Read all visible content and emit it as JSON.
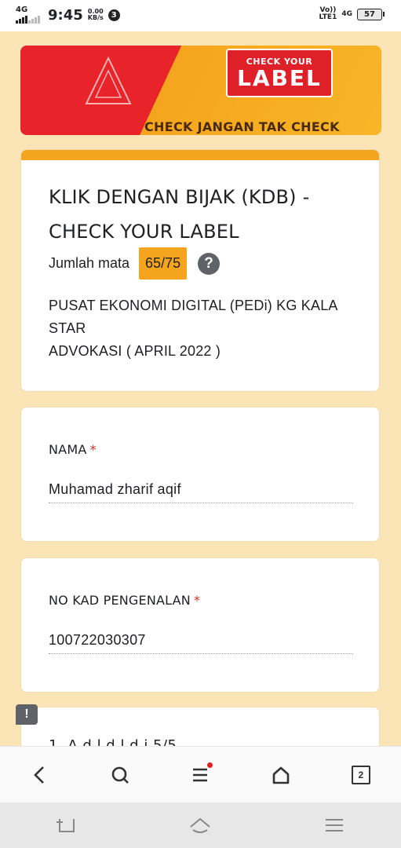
{
  "status_bar": {
    "signal_label": "4G",
    "time": "9:45",
    "speed_value": "0.00",
    "speed_unit": "KB/s",
    "notification_count": "3",
    "volte_top": "Vo))",
    "volte_bottom": "LTE1",
    "network_right": "4G",
    "battery": "57"
  },
  "banner": {
    "sign_top": "CHECK YOUR",
    "sign_main": "LABEL",
    "tagline": "CHECK JANGAN TAK CHECK",
    "accent_red": "#e8232a",
    "accent_orange": "#f5a51d"
  },
  "form": {
    "title": "KLIK DENGAN BIJAK (KDB) - CHECK YOUR LABEL",
    "score_label": "Jumlah mata",
    "score_value": "65/75",
    "description_line1": "PUSAT EKONOMI DIGITAL (PEDi) KG KALA STAR",
    "description_line2": "ADVOKASI ( APRIL 2022 )",
    "questions": [
      {
        "label": "NAMA",
        "required": "*",
        "answer": "Muhamad zharif aqif"
      },
      {
        "label": "NO KAD PENGENALAN",
        "required": "*",
        "answer": "100722030307"
      }
    ],
    "next_question_partial": "1. A d l     d l       d       i 5/5"
  },
  "browser_nav": {
    "tabs_count": "2",
    "icons": [
      "back-icon",
      "search-icon",
      "menu-icon",
      "home-icon",
      "tabs-icon"
    ]
  },
  "system_nav": {
    "icons": [
      "recent-apps-icon",
      "home-icon",
      "menu-icon"
    ]
  }
}
